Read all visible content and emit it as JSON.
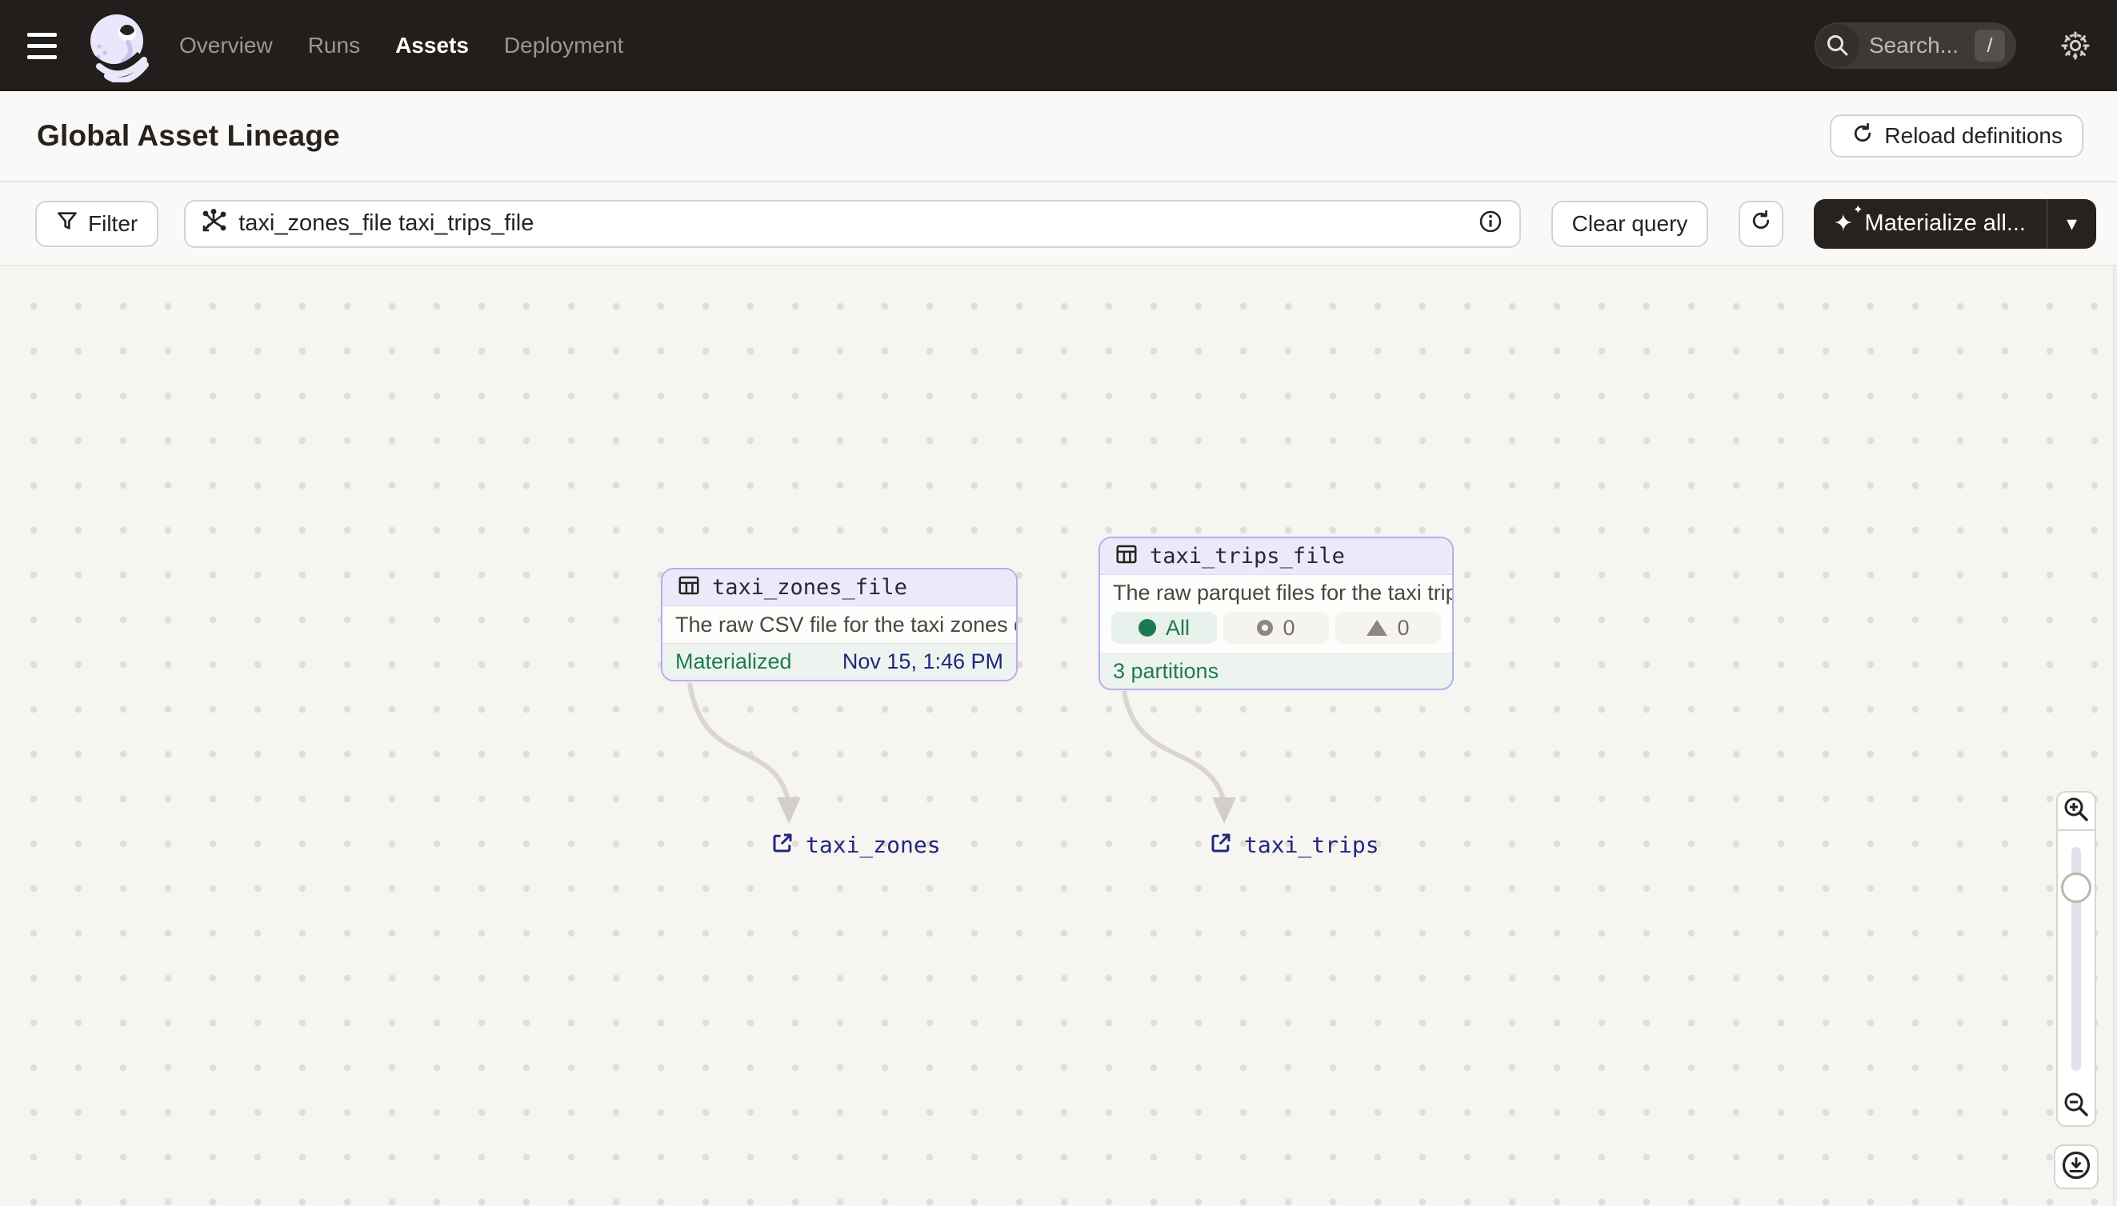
{
  "nav": {
    "menu": [
      {
        "label": "Overview",
        "active": false
      },
      {
        "label": "Runs",
        "active": false
      },
      {
        "label": "Assets",
        "active": true
      },
      {
        "label": "Deployment",
        "active": false
      }
    ],
    "search_placeholder": "Search...",
    "search_shortcut": "/"
  },
  "header": {
    "title": "Global Asset Lineage",
    "reload_label": "Reload definitions"
  },
  "toolbar": {
    "filter_label": "Filter",
    "query_value": "taxi_zones_file taxi_trips_file",
    "clear_query_label": "Clear query",
    "materialize_label": "Materialize all..."
  },
  "graph": {
    "nodes": [
      {
        "name": "taxi_zones_file",
        "description": "The raw CSV file for the taxi zones dat...",
        "status_label": "Materialized",
        "status_time": "Nov 15, 1:46 PM"
      },
      {
        "name": "taxi_trips_file",
        "description": "The raw parquet files for the taxi trips ...",
        "partition_all_label": "All",
        "partition_failed_count": "0",
        "partition_missing_count": "0",
        "footer_label": "3 partitions"
      }
    ],
    "external_assets": [
      {
        "name": "taxi_zones"
      },
      {
        "name": "taxi_trips"
      }
    ]
  },
  "icons": {
    "hamburger": "menu-bars",
    "logo": "dagster-octopus",
    "search": "magnifier",
    "settings": "gear",
    "reload": "refresh-arrow",
    "filter": "funnel",
    "query": "op-selection-graph",
    "info": "info-circle",
    "materialize": "sparkle",
    "asset": "table-grid",
    "external": "external-link-arrow",
    "zoom_in": "magnifier-plus",
    "zoom_out": "magnifier-minus",
    "download": "download-circle"
  },
  "colors": {
    "nav_bg": "#211E1C",
    "page_bg": "#FAF9F7",
    "canvas_bg": "#F6F5F2",
    "node_border": "#B5AFEC",
    "node_header_bg": "#ECEAFA",
    "status_green": "#217A52",
    "timestamp_navy": "#23257E",
    "external_link_navy": "#22277E",
    "edge_gray": "#D9D6D1",
    "materialize_btn_bg": "#26221F"
  }
}
